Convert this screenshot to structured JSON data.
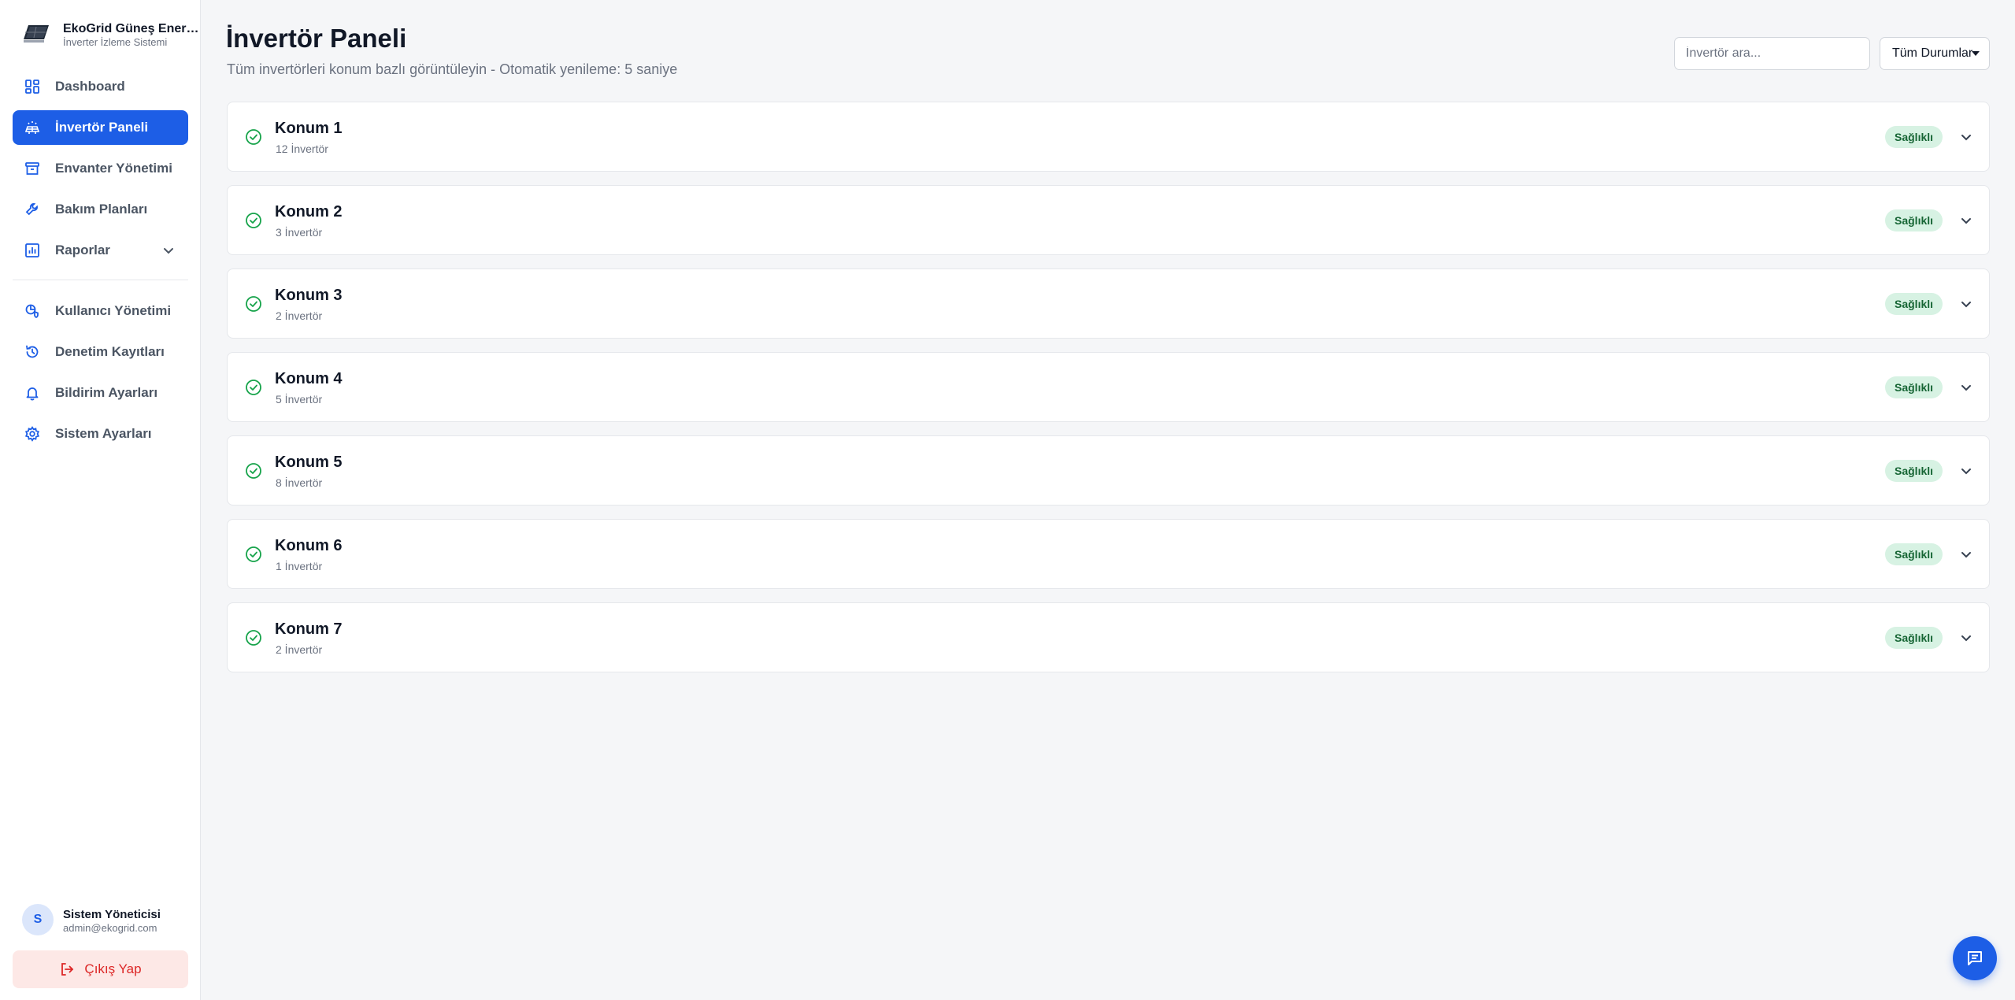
{
  "brand": {
    "title": "EkoGrid Güneş Enerjisi",
    "subtitle": "İnverter İzleme Sistemi",
    "logo_icon": "solar-panel-icon"
  },
  "sidebar": {
    "items": [
      {
        "label": "Dashboard",
        "icon": "grid-icon",
        "active": false
      },
      {
        "label": "İnvertör Paneli",
        "icon": "solar-inverter-icon",
        "active": true
      },
      {
        "label": "Envanter Yönetimi",
        "icon": "archive-icon",
        "active": false
      },
      {
        "label": "Bakım Planları",
        "icon": "wrench-icon",
        "active": false
      },
      {
        "label": "Raporlar",
        "icon": "bar-chart-icon",
        "active": false,
        "expandable": true
      },
      {
        "label": "Kullanıcı Yönetimi",
        "icon": "user-shield-icon",
        "active": false
      },
      {
        "label": "Denetim Kayıtları",
        "icon": "history-icon",
        "active": false
      },
      {
        "label": "Bildirim Ayarları",
        "icon": "bell-icon",
        "active": false
      },
      {
        "label": "Sistem Ayarları",
        "icon": "gear-icon",
        "active": false
      }
    ]
  },
  "user": {
    "initial": "S",
    "name": "Sistem Yöneticisi",
    "email": "admin@ekogrid.com"
  },
  "logout": {
    "label": "Çıkış Yap",
    "icon": "logout-icon"
  },
  "header": {
    "title": "İnvertör Paneli",
    "subtitle": "Tüm invertörleri konum bazlı görüntüleyin - Otomatik yenileme: 5 saniye"
  },
  "search": {
    "placeholder": "İnvertör ara..."
  },
  "status_filter": {
    "selected": "Tüm Durumlar"
  },
  "locations": [
    {
      "name": "Konum 1",
      "count": "12 İnvertör",
      "status": "Sağlıklı"
    },
    {
      "name": "Konum 2",
      "count": "3 İnvertör",
      "status": "Sağlıklı"
    },
    {
      "name": "Konum 3",
      "count": "2 İnvertör",
      "status": "Sağlıklı"
    },
    {
      "name": "Konum 4",
      "count": "5 İnvertör",
      "status": "Sağlıklı"
    },
    {
      "name": "Konum 5",
      "count": "8 İnvertör",
      "status": "Sağlıklı"
    },
    {
      "name": "Konum 6",
      "count": "1 İnvertör",
      "status": "Sağlıklı"
    },
    {
      "name": "Konum 7",
      "count": "2 İnvertör",
      "status": "Sağlıklı"
    }
  ],
  "colors": {
    "accent": "#1d5ee6",
    "healthy_bg": "#d7f2e3",
    "healthy_text": "#166534",
    "healthy_icon": "#16a34a",
    "danger": "#dc2626"
  }
}
